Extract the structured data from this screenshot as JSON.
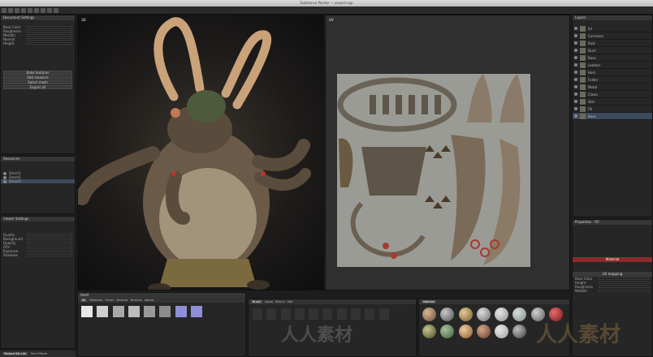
{
  "window": {
    "title": "Substance Painter — project.spp"
  },
  "left_top_panel": {
    "title": "Document Settings",
    "rows": [
      "Base Color",
      "Roughness",
      "Metallic",
      "Normal",
      "Height"
    ],
    "buttons": [
      "Bake textures",
      "Add resource",
      "Select mesh",
      "Export all"
    ]
  },
  "left_mid_panel": {
    "title": "Resources",
    "items": [
      "Smart1",
      "Smart2",
      "Smart3"
    ]
  },
  "left_bot_panel": {
    "title": "Viewer Settings",
    "rows": [
      "Quality",
      "Background",
      "Opacity",
      "FOV",
      "Exposure",
      "Shadows"
    ]
  },
  "viewport_3d": {
    "label": "3D"
  },
  "viewport_2d": {
    "label": "UV"
  },
  "layers_panel": {
    "title": "Layers",
    "layers": [
      "lid",
      "Corrosion",
      "Rust",
      "Dust",
      "Base",
      "Leather",
      "Horn",
      "Folder",
      "Metal",
      "Claws",
      "Skin",
      "Fill",
      "Base"
    ]
  },
  "properties_panel": {
    "title": "Properties - Fill",
    "section_material": "Material",
    "section_uv": "UV mapping",
    "rows": [
      "Base Color",
      "Height",
      "Roughness",
      "Metallic"
    ]
  },
  "shelf_left": {
    "title": "Shelf",
    "tabs": [
      "All",
      "Materials",
      "Smart",
      "Textures",
      "Brushes",
      "Alphas"
    ]
  },
  "shelf_mid": {
    "tabs": [
      "Brush",
      "Alpha",
      "Stencil",
      "Mat"
    ]
  },
  "shelf_right": {
    "tabs": [
      "Material"
    ]
  },
  "status_tabs": [
    "Texture Set List",
    "Post Effects"
  ],
  "watermark": {
    "text": "人人素材",
    "small_text": "人人素材"
  },
  "icons": [
    "eye-icon",
    "folder-icon",
    "brush-icon",
    "search-icon"
  ]
}
